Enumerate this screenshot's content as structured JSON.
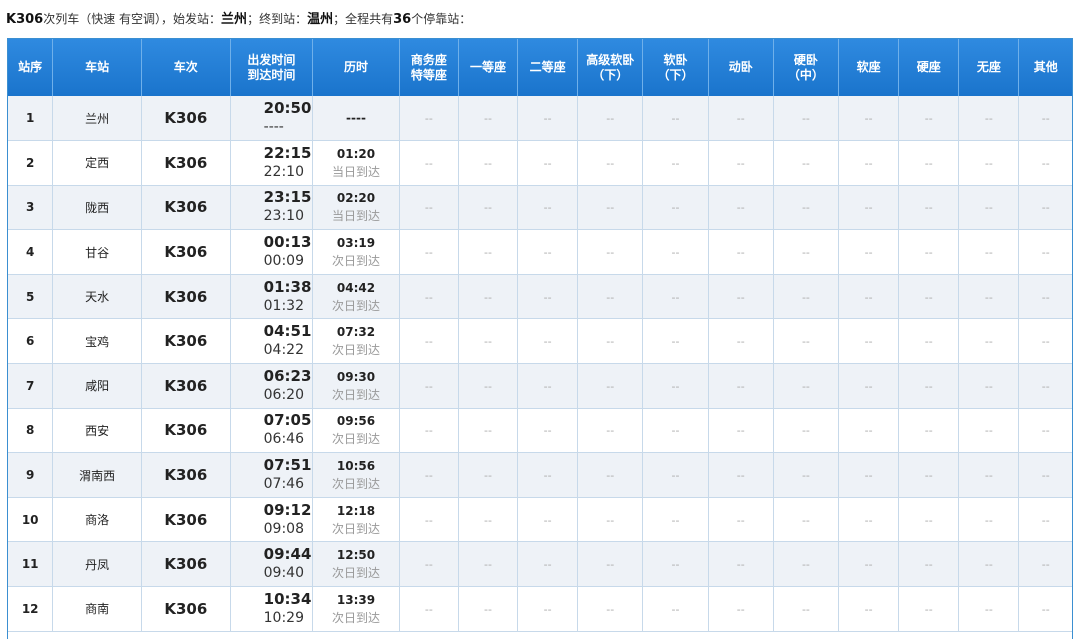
{
  "summary": {
    "train": "K306",
    "text1": "次列车（快速 有空调），始发站：",
    "origin": "兰州",
    "text2": "；终到站：",
    "terminal": "温州",
    "text3": "；全程共有",
    "stop_count": "36",
    "text4": "个停靠站："
  },
  "headers": {
    "idx": "站序",
    "station": "车站",
    "train": "车次",
    "time_l1": "出发时间",
    "time_l2": "到达时间",
    "duration": "历时",
    "business_l1": "商务座",
    "business_l2": "特等座",
    "first": "一等座",
    "second": "二等座",
    "premium_l1": "高级软卧",
    "premium_l2": "（下）",
    "soft_sleeper_l1": "软卧",
    "soft_sleeper_l2": "（下）",
    "emu_sleeper": "动卧",
    "hard_sleeper_l1": "硬卧",
    "hard_sleeper_l2": "（中）",
    "soft_seat": "软座",
    "hard_seat": "硬座",
    "no_seat": "无座",
    "other": "其他"
  },
  "rows": [
    {
      "idx": "1",
      "station": "兰州",
      "train": "K306",
      "dep": "20:50",
      "arr": "----",
      "duration": "----",
      "arrival_day": ""
    },
    {
      "idx": "2",
      "station": "定西",
      "train": "K306",
      "dep": "22:15",
      "arr": "22:10",
      "duration": "01:20",
      "arrival_day": "当日到达"
    },
    {
      "idx": "3",
      "station": "陇西",
      "train": "K306",
      "dep": "23:15",
      "arr": "23:10",
      "duration": "02:20",
      "arrival_day": "当日到达"
    },
    {
      "idx": "4",
      "station": "甘谷",
      "train": "K306",
      "dep": "00:13",
      "arr": "00:09",
      "duration": "03:19",
      "arrival_day": "次日到达"
    },
    {
      "idx": "5",
      "station": "天水",
      "train": "K306",
      "dep": "01:38",
      "arr": "01:32",
      "duration": "04:42",
      "arrival_day": "次日到达"
    },
    {
      "idx": "6",
      "station": "宝鸡",
      "train": "K306",
      "dep": "04:51",
      "arr": "04:22",
      "duration": "07:32",
      "arrival_day": "次日到达"
    },
    {
      "idx": "7",
      "station": "咸阳",
      "train": "K306",
      "dep": "06:23",
      "arr": "06:20",
      "duration": "09:30",
      "arrival_day": "次日到达"
    },
    {
      "idx": "8",
      "station": "西安",
      "train": "K306",
      "dep": "07:05",
      "arr": "06:46",
      "duration": "09:56",
      "arrival_day": "次日到达"
    },
    {
      "idx": "9",
      "station": "渭南西",
      "train": "K306",
      "dep": "07:51",
      "arr": "07:46",
      "duration": "10:56",
      "arrival_day": "次日到达"
    },
    {
      "idx": "10",
      "station": "商洛",
      "train": "K306",
      "dep": "09:12",
      "arr": "09:08",
      "duration": "12:18",
      "arrival_day": "次日到达"
    },
    {
      "idx": "11",
      "station": "丹凤",
      "train": "K306",
      "dep": "09:44",
      "arr": "09:40",
      "duration": "12:50",
      "arrival_day": "次日到达"
    },
    {
      "idx": "12",
      "station": "商南",
      "train": "K306",
      "dep": "10:34",
      "arr": "10:29",
      "duration": "13:39",
      "arrival_day": "次日到达"
    }
  ],
  "empty_cell": "--",
  "colors": {
    "header_bg": "#1a74cc",
    "header_text": "#ffffff",
    "row_alt_bg": "#eef2f7",
    "grid_line": "#c7d9ea",
    "muted_text": "#999999"
  }
}
